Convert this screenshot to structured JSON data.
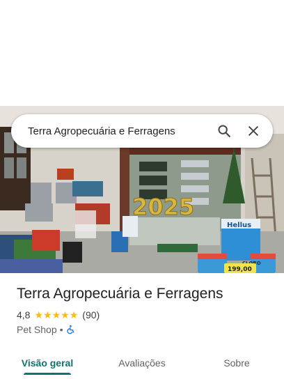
{
  "search": {
    "query": "Terra Agropecuária e Ferragens"
  },
  "photo": {
    "banner_text": "2025",
    "bucket_brand": "Hellus",
    "price_tag": "199,00",
    "bucket_label": "CLORO"
  },
  "place": {
    "name": "Terra Agropecuária e Ferragens",
    "rating": "4,8",
    "stars": 5,
    "review_count": "(90)",
    "category": "Pet Shop",
    "separator": "•"
  },
  "tabs": [
    {
      "label": "Visão geral",
      "active": true
    },
    {
      "label": "Avaliações",
      "active": false
    },
    {
      "label": "Sobre",
      "active": false
    }
  ],
  "colors": {
    "accent": "#0b7570",
    "star": "#fbbc04",
    "wheelchair": "#1a73e8"
  },
  "icons": [
    "search-icon",
    "close-icon",
    "star-icon",
    "wheelchair-icon"
  ]
}
